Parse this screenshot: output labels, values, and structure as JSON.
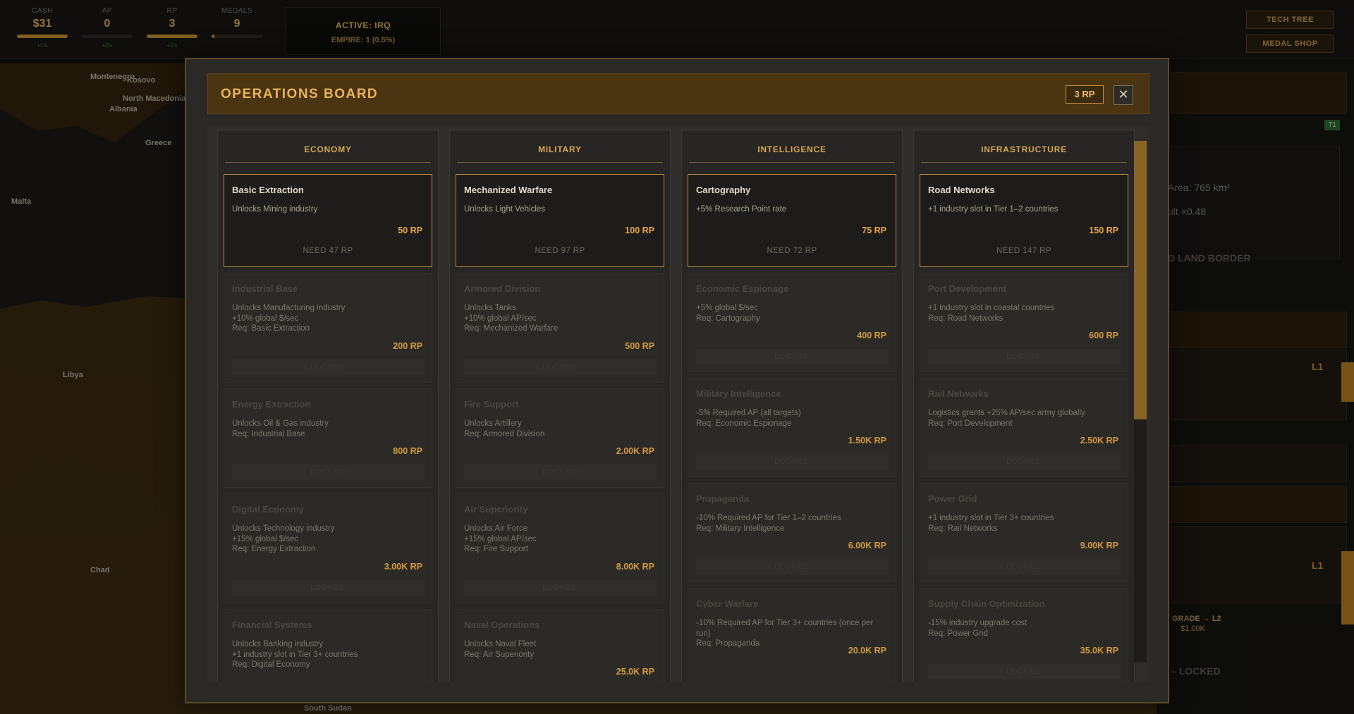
{
  "hud": {
    "stats": [
      {
        "label": "CASH",
        "value": "$31",
        "sub": "+1/s",
        "fill": 1.0
      },
      {
        "label": "AP",
        "value": "0",
        "sub": "+0/s",
        "fill": 0.0
      },
      {
        "label": "RP",
        "value": "3",
        "sub": "+0/s",
        "fill": 1.0
      },
      {
        "label": "MEDALS",
        "value": "9",
        "sub": "",
        "fill": 0.05
      }
    ],
    "active": "ACTIVE: IRQ",
    "empire": "EMPIRE: 1 (0.5%)",
    "tech_tree": "TECH TREE",
    "medal_shop": "MEDAL SHOP"
  },
  "map_labels": {
    "montenegro": "Montenegro",
    "kosovo": "Kosovo",
    "albania": "Albania",
    "north_macedonia": "North Macedonia",
    "greece": "Greece",
    "malta": "Malta",
    "libya": "Libya",
    "chad": "Chad",
    "south_sudan": "South Sudan"
  },
  "side_panel": {
    "badge": "T1",
    "area": "Area: 765 km²",
    "mult": "ult ×0.48",
    "border": "D LAND BORDER",
    "l1a": "L1",
    "l1b": "L1",
    "upgrade": "GRADE → L2",
    "upgrade_cost": "$1.00K",
    "locked": "– LOCKED"
  },
  "modal": {
    "title": "OPERATIONS BOARD",
    "rp_badge": "3 RP",
    "close": "✕"
  },
  "columns": [
    {
      "name": "ECONOMY",
      "cards": [
        {
          "title": "Basic Extraction",
          "desc": "Unlocks Mining industry",
          "cost": "50 RP",
          "status": "NEED 47 RP",
          "active": true
        },
        {
          "title": "Industrial Base",
          "desc": "Unlocks Manufacturing industry\n+10% global $/sec\nReq: Basic Extraction",
          "cost": "200 RP",
          "status": "LOCKED",
          "active": false
        },
        {
          "title": "Energy Extraction",
          "desc": "Unlocks Oil & Gas industry\nReq: Industrial Base",
          "cost": "800 RP",
          "status": "LOCKED",
          "active": false
        },
        {
          "title": "Digital Economy",
          "desc": "Unlocks Technology industry\n+15% global $/sec\nReq: Energy Extraction",
          "cost": "3.00K RP",
          "status": "LOCKED",
          "active": false
        },
        {
          "title": "Financial Systems",
          "desc": "Unlocks Banking industry\n+1 industry slot in Tier 3+ countries\nReq: Digital Economy",
          "cost": "",
          "status": "",
          "active": false
        }
      ]
    },
    {
      "name": "MILITARY",
      "cards": [
        {
          "title": "Mechanized Warfare",
          "desc": "Unlocks Light Vehicles",
          "cost": "100 RP",
          "status": "NEED 97 RP",
          "active": true
        },
        {
          "title": "Armored Division",
          "desc": "Unlocks Tanks\n+10% global AP/sec\nReq: Mechanized Warfare",
          "cost": "500 RP",
          "status": "LOCKED",
          "active": false
        },
        {
          "title": "Fire Support",
          "desc": "Unlocks Artillery\nReq: Armored Division",
          "cost": "2.00K RP",
          "status": "LOCKED",
          "active": false
        },
        {
          "title": "Air Superiority",
          "desc": "Unlocks Air Force\n+15% global AP/sec\nReq: Fire Support",
          "cost": "8.00K RP",
          "status": "LOCKED",
          "active": false
        },
        {
          "title": "Naval Operations",
          "desc": "Unlocks Naval Fleet\nReq: Air Superiority",
          "cost": "25.0K RP",
          "status": "",
          "active": false
        }
      ]
    },
    {
      "name": "INTELLIGENCE",
      "cards": [
        {
          "title": "Cartography",
          "desc": "+5% Research Point rate",
          "cost": "75 RP",
          "status": "NEED 72 RP",
          "active": true
        },
        {
          "title": "Economic Espionage",
          "desc": "+5% global $/sec\nReq: Cartography",
          "cost": "400 RP",
          "status": "LOCKED",
          "active": false
        },
        {
          "title": "Military Intelligence",
          "desc": "-5% Required AP (all targets)\nReq: Economic Espionage",
          "cost": "1.50K RP",
          "status": "LOCKED",
          "active": false
        },
        {
          "title": "Propaganda",
          "desc": "-10% Required AP for Tier 1–2 countries\nReq: Military Intelligence",
          "cost": "6.00K RP",
          "status": "LOCKED",
          "active": false
        },
        {
          "title": "Cyber Warfare",
          "desc": "-10% Required AP for Tier 3+ countries (once per run)\nReq: Propaganda",
          "cost": "20.0K RP",
          "status": "",
          "active": false
        }
      ]
    },
    {
      "name": "INFRASTRUCTURE",
      "cards": [
        {
          "title": "Road Networks",
          "desc": "+1 industry slot in Tier 1–2 countries",
          "cost": "150 RP",
          "status": "NEED 147 RP",
          "active": true
        },
        {
          "title": "Port Development",
          "desc": "+1 industry slot in coastal countries\nReq: Road Networks",
          "cost": "600 RP",
          "status": "LOCKED",
          "active": false
        },
        {
          "title": "Rail Networks",
          "desc": "Logistics grants +25% AP/sec army globally\nReq: Port Development",
          "cost": "2.50K RP",
          "status": "LOCKED",
          "active": false
        },
        {
          "title": "Power Grid",
          "desc": "+1 industry slot in Tier 3+ countries\nReq: Rail Networks",
          "cost": "9.00K RP",
          "status": "LOCKED",
          "active": false
        },
        {
          "title": "Supply Chain Optimization",
          "desc": "-15% industry upgrade cost\nReq: Power Grid",
          "cost": "35.0K RP",
          "status": "LOCKED",
          "active": false
        }
      ]
    }
  ]
}
